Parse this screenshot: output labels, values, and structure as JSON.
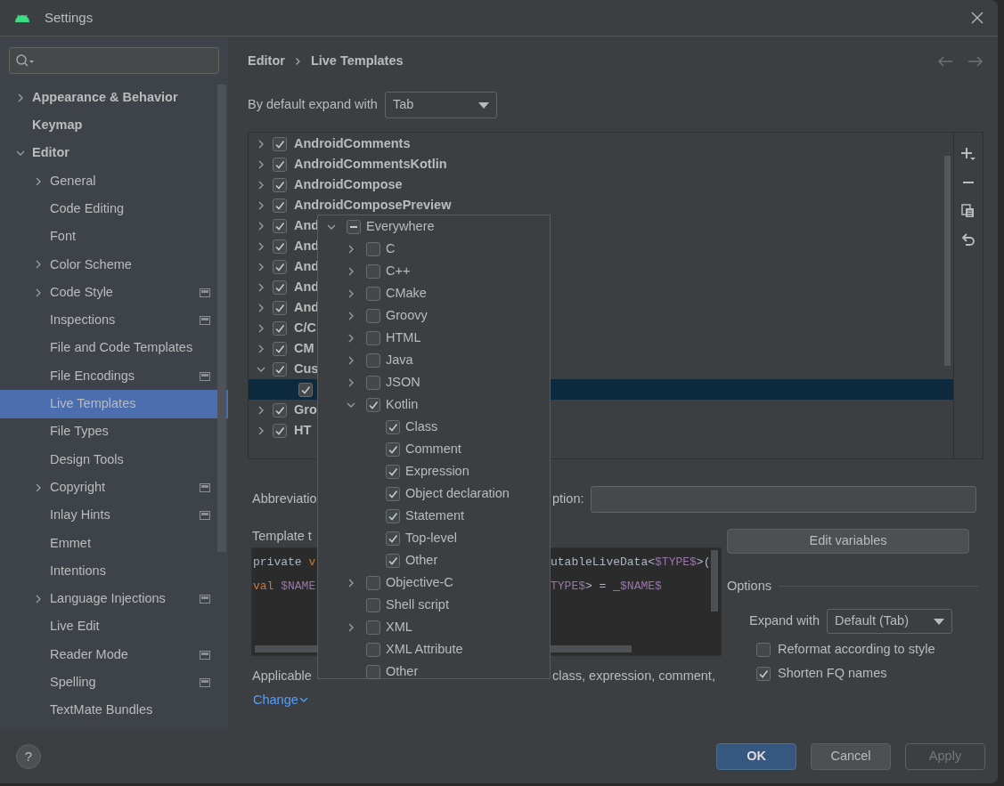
{
  "window": {
    "title": "Settings"
  },
  "sidebar": {
    "items": [
      {
        "label": "Appearance & Behavior",
        "expanded": false,
        "selected": false
      },
      {
        "label": "Keymap",
        "selected": false
      },
      {
        "label": "Editor",
        "expanded": true,
        "selected": false,
        "children": [
          {
            "label": "General",
            "expanded": false,
            "selected": false
          },
          {
            "label": "Code Editing",
            "selected": false
          },
          {
            "label": "Font",
            "selected": false
          },
          {
            "label": "Color Scheme",
            "expanded": false,
            "selected": false
          },
          {
            "label": "Code Style",
            "expanded": false,
            "selected": false,
            "scoped": true
          },
          {
            "label": "Inspections",
            "selected": false,
            "scoped": true
          },
          {
            "label": "File and Code Templates",
            "selected": false
          },
          {
            "label": "File Encodings",
            "selected": false,
            "scoped": true
          },
          {
            "label": "Live Templates",
            "selected": true
          },
          {
            "label": "File Types",
            "selected": false
          },
          {
            "label": "Design Tools",
            "selected": false
          },
          {
            "label": "Copyright",
            "expanded": false,
            "selected": false,
            "scoped": true
          },
          {
            "label": "Inlay Hints",
            "selected": false,
            "scoped": true
          },
          {
            "label": "Emmet",
            "selected": false
          },
          {
            "label": "Intentions",
            "selected": false
          },
          {
            "label": "Language Injections",
            "expanded": false,
            "selected": false,
            "scoped": true
          },
          {
            "label": "Live Edit",
            "selected": false
          },
          {
            "label": "Reader Mode",
            "selected": false,
            "scoped": true
          },
          {
            "label": "Spelling",
            "selected": false,
            "scoped": true
          },
          {
            "label": "TextMate Bundles",
            "selected": false
          }
        ]
      }
    ]
  },
  "breadcrumb": [
    "Editor",
    "Live Templates"
  ],
  "expand_default": {
    "label": "By default expand with",
    "value": "Tab"
  },
  "template_groups": [
    {
      "name": "AndroidComments",
      "checked": true,
      "expanded": false,
      "selected": false
    },
    {
      "name": "AndroidCommentsKotlin",
      "checked": true,
      "expanded": false,
      "selected": false
    },
    {
      "name": "AndroidCompose",
      "checked": true,
      "expanded": false,
      "selected": false
    },
    {
      "name": "AndroidComposePreview",
      "checked": true,
      "expanded": false,
      "selected": false
    },
    {
      "name": "And",
      "checked": true,
      "expanded": false,
      "selected": false
    },
    {
      "name": "And",
      "checked": true,
      "expanded": false,
      "selected": false
    },
    {
      "name": "And",
      "checked": true,
      "expanded": false,
      "selected": false
    },
    {
      "name": "And",
      "checked": true,
      "expanded": false,
      "selected": false
    },
    {
      "name": "And",
      "checked": true,
      "expanded": false,
      "selected": false
    },
    {
      "name": "C/C",
      "checked": true,
      "expanded": false,
      "selected": false
    },
    {
      "name": "CM",
      "checked": true,
      "expanded": false,
      "selected": false
    },
    {
      "name": "Cus",
      "checked": true,
      "expanded": true,
      "selected": false,
      "children": [
        {
          "checked": true,
          "selected": true
        }
      ]
    },
    {
      "name": "Gro",
      "checked": true,
      "expanded": false,
      "selected": false
    },
    {
      "name": "HT",
      "checked": true,
      "expanded": false,
      "selected": false
    }
  ],
  "form": {
    "abbreviation_label": "Abbreviatio",
    "description_label": "ption:",
    "template_label": "Template t",
    "code_lines": [
      {
        "left": [
          {
            "kind": "plain",
            "text": "private "
          },
          {
            "kind": "keyword",
            "text": "v"
          }
        ],
        "right": [
          {
            "kind": "plain",
            "text": "utableLiveData<"
          },
          {
            "kind": "variable",
            "text": "$TYPE$"
          },
          {
            "kind": "plain",
            "text": ">("
          }
        ]
      },
      {
        "left": [
          {
            "kind": "keyword",
            "text": "val "
          },
          {
            "kind": "variable",
            "text": "$NAME"
          }
        ],
        "right": [
          {
            "kind": "variable",
            "text": "TYPE$"
          },
          {
            "kind": "plain",
            "text": "> = _"
          },
          {
            "kind": "variable",
            "text": "$NAME$"
          }
        ]
      }
    ],
    "applicable_label": "Applicable",
    "applicable_text": "class, expression, comment,",
    "change_link": "Change",
    "edit_variables": "Edit variables",
    "options": {
      "title": "Options",
      "expand_label": "Expand with",
      "expand_value": "Default (Tab)",
      "checkboxes": [
        {
          "label": "Reformat according to style",
          "checked": false
        },
        {
          "label": "Shorten FQ names",
          "checked": true
        }
      ]
    }
  },
  "contexts": [
    {
      "label": "Everywhere",
      "checked": false,
      "partial": true,
      "expanded": true,
      "children": [
        {
          "label": "C",
          "checked": false,
          "partial": false,
          "expanded": false
        },
        {
          "label": "C++",
          "checked": false,
          "partial": false,
          "expanded": false
        },
        {
          "label": "CMake",
          "checked": false,
          "partial": false,
          "expanded": false
        },
        {
          "label": "Groovy",
          "checked": false,
          "partial": false,
          "expanded": false
        },
        {
          "label": "HTML",
          "checked": false,
          "partial": false,
          "expanded": false
        },
        {
          "label": "Java",
          "checked": false,
          "partial": false,
          "expanded": false
        },
        {
          "label": "JSON",
          "checked": false,
          "partial": false,
          "expanded": false
        },
        {
          "label": "Kotlin",
          "checked": true,
          "partial": false,
          "expanded": true,
          "children": [
            {
              "label": "Class",
              "checked": true,
              "partial": false
            },
            {
              "label": "Comment",
              "checked": true,
              "partial": false
            },
            {
              "label": "Expression",
              "checked": true,
              "partial": false
            },
            {
              "label": "Object declaration",
              "checked": true,
              "partial": false
            },
            {
              "label": "Statement",
              "checked": true,
              "partial": false
            },
            {
              "label": "Top-level",
              "checked": true,
              "partial": false
            },
            {
              "label": "Other",
              "checked": true,
              "partial": false
            }
          ]
        },
        {
          "label": "Objective-C",
          "checked": false,
          "partial": false,
          "expanded": false
        },
        {
          "label": "Shell script",
          "checked": false,
          "partial": false
        },
        {
          "label": "XML",
          "checked": false,
          "partial": false,
          "expanded": false
        },
        {
          "label": "XML Attribute",
          "checked": false,
          "partial": false
        },
        {
          "label": "Other",
          "checked": false,
          "partial": false
        }
      ]
    }
  ],
  "help": "?",
  "buttons": [
    {
      "label": "OK",
      "kind": "primary"
    },
    {
      "label": "Cancel",
      "kind": "normal"
    },
    {
      "label": "Apply",
      "kind": "disabled"
    }
  ]
}
